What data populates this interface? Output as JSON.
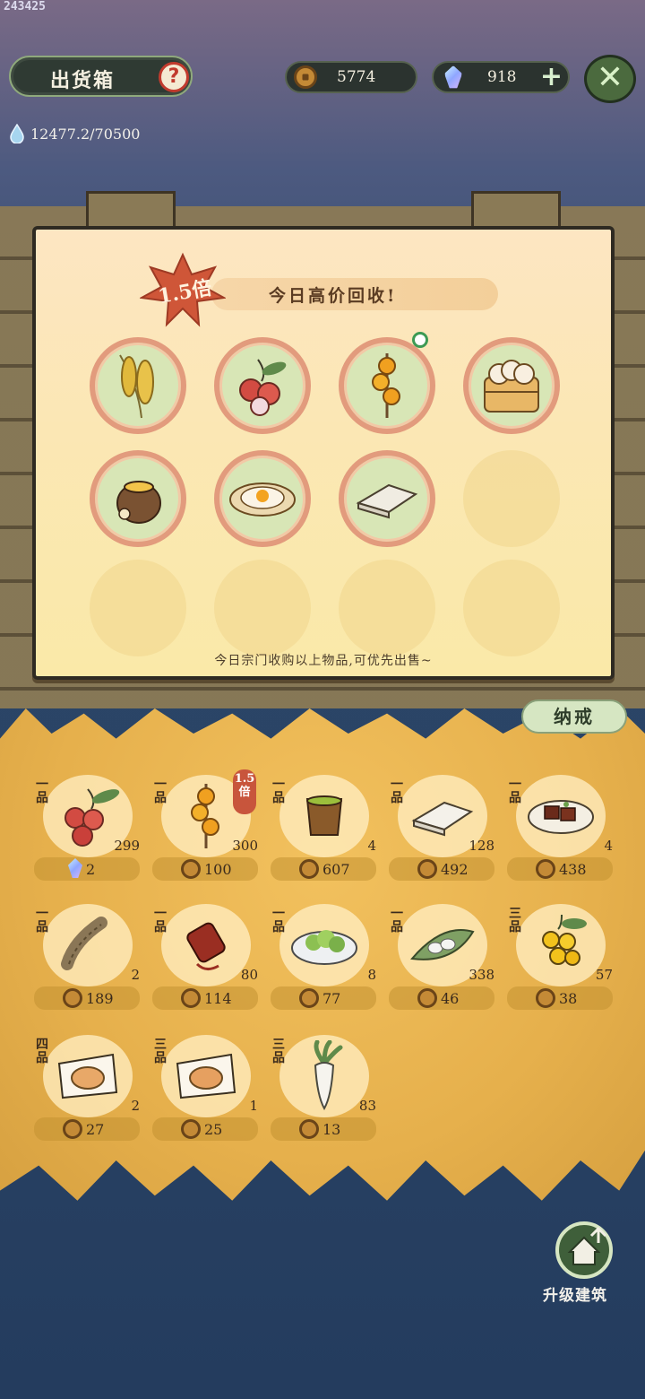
{
  "corner_id": "243425",
  "header": {
    "title": "出货箱",
    "help": "?",
    "water": "12477.2/70500",
    "coins": "5774",
    "gems": "918",
    "plus": "+",
    "close": "✕"
  },
  "board": {
    "multiplier": "1.5倍",
    "banner": "今日高价回收!",
    "note": "今日宗门收购以上物品,可优先出售~",
    "slots": [
      {
        "icon": "millet-icon"
      },
      {
        "icon": "lychee-icon"
      },
      {
        "icon": "candied-fruit-skewer-icon",
        "marked": true
      },
      {
        "icon": "steamed-buns-icon"
      },
      {
        "icon": "herbal-jar-icon"
      },
      {
        "icon": "fried-egg-icon"
      },
      {
        "icon": "cloth-roll-icon"
      },
      {
        "icon": "empty"
      },
      {
        "icon": "empty"
      },
      {
        "icon": "empty"
      },
      {
        "icon": "empty"
      },
      {
        "icon": "empty"
      }
    ]
  },
  "storage": {
    "tab": "纳戒",
    "items": [
      {
        "grade": "一品",
        "count": "299",
        "price": "2",
        "currency": "gem",
        "icon": "lychee-icon"
      },
      {
        "grade": "一品",
        "count": "300",
        "price": "100",
        "currency": "coin",
        "icon": "candied-fruit-skewer-icon",
        "badge": "1.5倍"
      },
      {
        "grade": "一品",
        "count": "4",
        "price": "607",
        "currency": "coin",
        "icon": "tea-cup-icon"
      },
      {
        "grade": "一品",
        "count": "128",
        "price": "492",
        "currency": "coin",
        "icon": "cloth-icon"
      },
      {
        "grade": "一品",
        "count": "4",
        "price": "438",
        "currency": "coin",
        "icon": "braised-tofu-icon"
      },
      {
        "grade": "一品",
        "count": "2",
        "price": "189",
        "currency": "coin",
        "icon": "rope-icon"
      },
      {
        "grade": "一品",
        "count": "80",
        "price": "114",
        "currency": "coin",
        "icon": "thread-spool-icon"
      },
      {
        "grade": "一品",
        "count": "8",
        "price": "77",
        "currency": "coin",
        "icon": "vegetable-plate-icon"
      },
      {
        "grade": "一品",
        "count": "338",
        "price": "46",
        "currency": "coin",
        "icon": "eggs-on-leaf-icon"
      },
      {
        "grade": "三品",
        "count": "57",
        "price": "38",
        "currency": "coin",
        "icon": "golden-grapes-icon"
      },
      {
        "grade": "四品",
        "count": "2",
        "price": "27",
        "currency": "coin",
        "icon": "pastry-icon"
      },
      {
        "grade": "三品",
        "count": "1",
        "price": "25",
        "currency": "coin",
        "icon": "pastry-icon"
      },
      {
        "grade": "三品",
        "count": "83",
        "price": "13",
        "currency": "coin",
        "icon": "radish-icon"
      }
    ]
  },
  "upgrade": {
    "label": "升级建筑"
  }
}
